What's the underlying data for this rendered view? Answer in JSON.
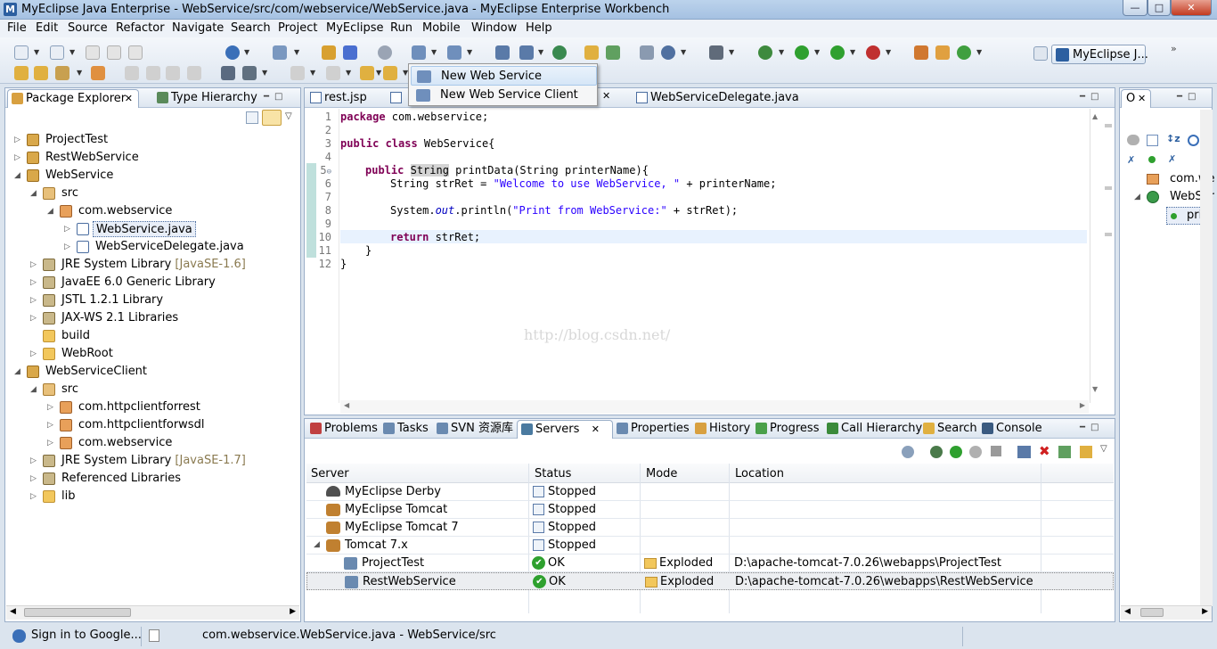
{
  "window": {
    "title": "MyEclipse Java Enterprise - WebService/src/com/webservice/WebService.java - MyEclipse Enterprise Workbench",
    "app_icon": "myeclipse-logo"
  },
  "menubar": [
    "File",
    "Edit",
    "Source",
    "Refactor",
    "Navigate",
    "Search",
    "Project",
    "MyEclipse",
    "Run",
    "Mobile",
    "Window",
    "Help"
  ],
  "perspective": {
    "label": "MyEclipse J..."
  },
  "dropdown": {
    "items": [
      {
        "label": "New Web Service",
        "highlighted": true
      },
      {
        "label": "New Web Service Client",
        "highlighted": false
      }
    ]
  },
  "left_panel": {
    "tabs": [
      "Package Explorer",
      "Type Hierarchy"
    ],
    "tree": [
      {
        "label": "ProjectTest",
        "type": "project"
      },
      {
        "label": "RestWebService",
        "type": "project"
      },
      {
        "label": "WebService",
        "type": "project"
      },
      {
        "label": "src",
        "type": "src-folder"
      },
      {
        "label": "com.webservice",
        "type": "package"
      },
      {
        "label": "WebService.java",
        "type": "java-file",
        "selected": true
      },
      {
        "label": "WebServiceDelegate.java",
        "type": "java-file"
      },
      {
        "label": "JRE System Library",
        "suffix": "[JavaSE-1.6]",
        "type": "library"
      },
      {
        "label": "JavaEE 6.0 Generic Library",
        "type": "library"
      },
      {
        "label": "JSTL 1.2.1 Library",
        "type": "library"
      },
      {
        "label": "JAX-WS 2.1 Libraries",
        "type": "library"
      },
      {
        "label": "build",
        "type": "folder"
      },
      {
        "label": "WebRoot",
        "type": "folder"
      },
      {
        "label": "WebServiceClient",
        "type": "project"
      },
      {
        "label": "src",
        "type": "src-folder"
      },
      {
        "label": "com.httpclientforrest",
        "type": "package"
      },
      {
        "label": "com.httpclientforwsdl",
        "type": "package"
      },
      {
        "label": "com.webservice",
        "type": "package"
      },
      {
        "label": "JRE System Library",
        "suffix": "[JavaSE-1.7]",
        "type": "library"
      },
      {
        "label": "Referenced Libraries",
        "type": "library"
      },
      {
        "label": "lib",
        "type": "folder"
      }
    ]
  },
  "editor": {
    "tabs": [
      "rest.jsp",
      "WebServiceDelegate.java"
    ],
    "line_numbers": [
      "1",
      "2",
      "3",
      "4",
      "5",
      "6",
      "7",
      "8",
      "9",
      "10",
      "11",
      "12"
    ],
    "code": {
      "l1_kw": "package",
      "l1_rest": " com.webservice;",
      "l3_kw": "public class",
      "l3_rest": " WebService{",
      "l5_kw": "public",
      "l5_type": "String",
      "l5_rest": " printData(String printerName){",
      "l6_a": "String strRet = ",
      "l6_str": "\"Welcome to use WebService, \"",
      "l6_b": " + printerName;",
      "l8_a": "System.",
      "l8_fld": "out",
      "l8_b": ".println(",
      "l8_str": "\"Print from WebService:\"",
      "l8_c": " + strRet);",
      "l10_kw": "return",
      "l10_rest": " strRet;",
      "l11": "}",
      "l12": "}"
    },
    "watermark": "http://blog.csdn.net/"
  },
  "outline_panel": {
    "tab": "O",
    "items": [
      "com.we",
      "WebSer",
      "prir"
    ]
  },
  "bottom_panel": {
    "tabs": [
      "Problems",
      "Tasks",
      "SVN 资源库",
      "Servers",
      "Properties",
      "History",
      "Progress",
      "Call Hierarchy",
      "Search",
      "Console"
    ],
    "columns": [
      "Server",
      "Status",
      "Mode",
      "Location"
    ],
    "rows": [
      {
        "server": "MyEclipse Derby",
        "status": "Stopped",
        "mode": "",
        "location": ""
      },
      {
        "server": "MyEclipse Tomcat",
        "status": "Stopped",
        "mode": "",
        "location": ""
      },
      {
        "server": "MyEclipse Tomcat 7",
        "status": "Stopped",
        "mode": "",
        "location": ""
      },
      {
        "server": "Tomcat  7.x",
        "status": "Stopped",
        "mode": "",
        "location": ""
      },
      {
        "server": "ProjectTest",
        "status": "OK",
        "mode": "Exploded",
        "location": "D:\\apache-tomcat-7.0.26\\webapps\\ProjectTest"
      },
      {
        "server": "RestWebService",
        "status": "OK",
        "mode": "Exploded",
        "location": "D:\\apache-tomcat-7.0.26\\webapps\\RestWebService"
      }
    ]
  },
  "statusbar": {
    "signin": "Sign in to Google...",
    "path": "com.webservice.WebService.java - WebService/src"
  },
  "colors": {
    "accent": "#2c5fa0",
    "keyword": "#7f0055",
    "string": "#2a00ff",
    "ok_green": "#2ea02e"
  }
}
